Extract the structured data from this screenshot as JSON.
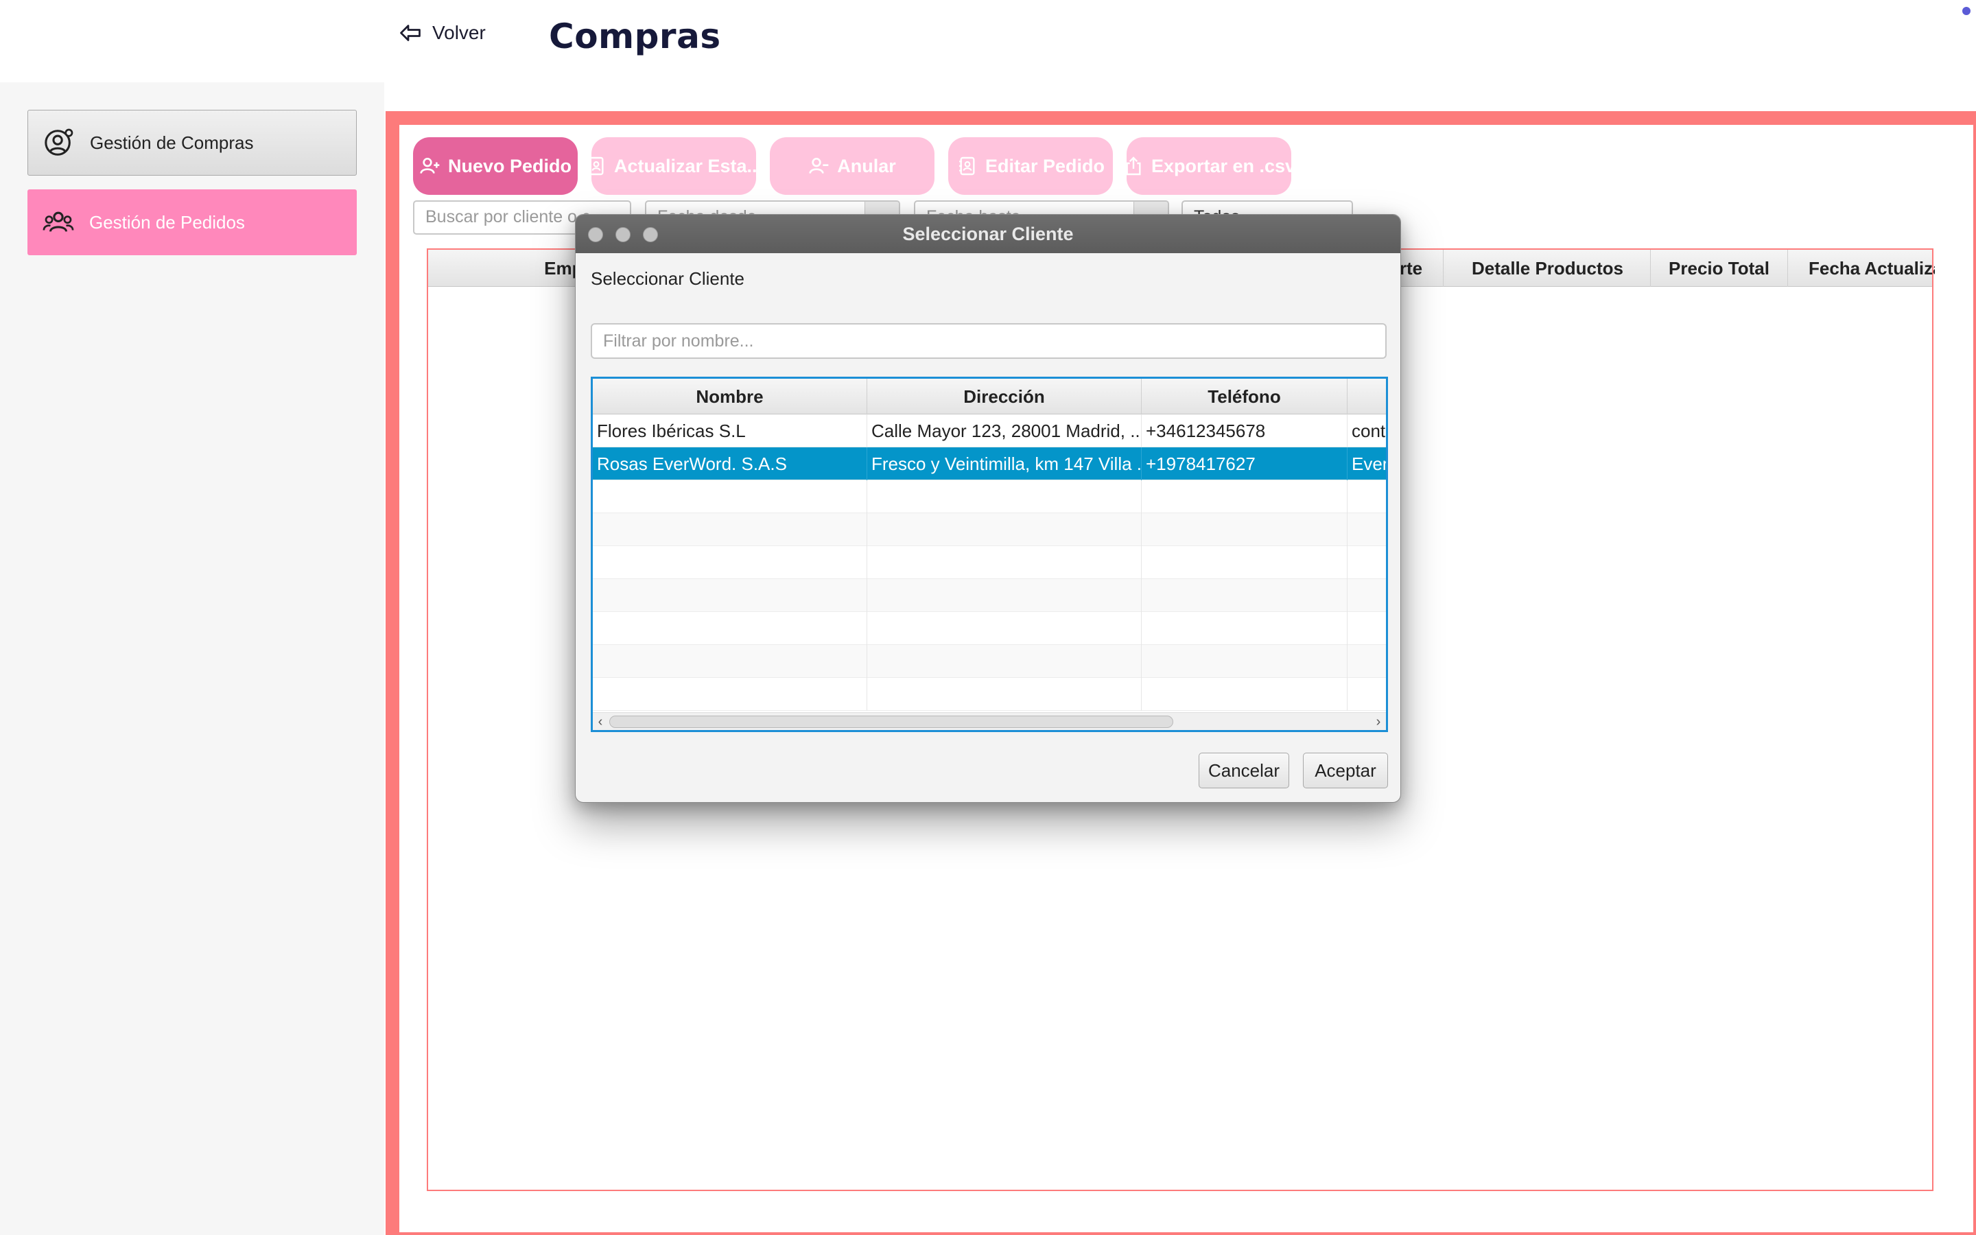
{
  "header": {
    "back_label": "Volver",
    "title": "Compras"
  },
  "sidebar": {
    "items": [
      {
        "label": "Gestión de Compras",
        "icon": "user-gear-icon"
      },
      {
        "label": "Gestión de Pedidos",
        "icon": "users-icon"
      }
    ]
  },
  "toolbar": {
    "buttons": [
      {
        "label": "Nuevo Pedido",
        "icon": "user-plus-icon"
      },
      {
        "label": "Actualizar Esta...",
        "icon": "contact-book-icon"
      },
      {
        "label": "Anular",
        "icon": "user-minus-icon"
      },
      {
        "label": "Editar Pedido",
        "icon": "contact-book-icon"
      },
      {
        "label": "Exportar en .csv",
        "icon": "share-icon"
      }
    ]
  },
  "filters": {
    "search_placeholder": "Buscar por cliente o c",
    "date_from_placeholder": "Fecha desde",
    "date_to_placeholder": "Fecha hasta",
    "state_value": "Todos"
  },
  "orders_table": {
    "columns": [
      "Empresa",
      "orte",
      "Detalle Productos",
      "Precio Total",
      "Fecha Actualiza"
    ]
  },
  "dialog": {
    "title": "Seleccionar Cliente",
    "subtitle": "Seleccionar Cliente",
    "filter_placeholder": "Filtrar por nombre...",
    "columns": [
      "Nombre",
      "Dirección",
      "Teléfono",
      ""
    ],
    "rows": [
      {
        "nombre": "Flores Ibéricas S.L",
        "direccion": "Calle Mayor 123, 28001 Madrid, ...",
        "telefono": "+34612345678",
        "extra": "cont"
      },
      {
        "nombre": "Rosas EverWord. S.A.S",
        "direccion": "Fresco y Veintimilla, km 147 Villa ...",
        "telefono": "+1978417627",
        "extra": "Ever"
      }
    ],
    "selected_row": 1,
    "cancel_label": "Cancelar",
    "accept_label": "Aceptar"
  },
  "colors": {
    "accent_pink": "#e5649c",
    "pink_light": "#ffc4dd",
    "sidebar_active": "#ff88bb",
    "frame_red": "#fd7b7b",
    "selection_blue": "#0495c9"
  }
}
